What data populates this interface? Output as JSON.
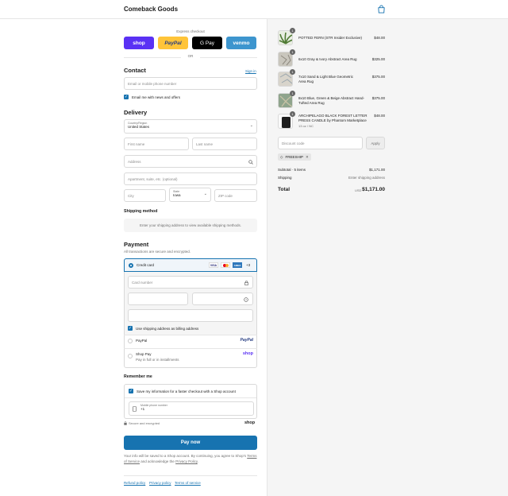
{
  "header": {
    "store_name": "Comeback Goods",
    "bag_icon": "shopping-bag-icon"
  },
  "express": {
    "label": "Express checkout",
    "buttons": [
      {
        "label": "shop",
        "color": "#5a31f4"
      },
      {
        "label": "PayPal",
        "color": "#ffc439"
      },
      {
        "label": "G Pay",
        "color": "#000000"
      },
      {
        "label": "venmo",
        "color": "#3d95ce"
      }
    ],
    "or_label": "OR"
  },
  "contact": {
    "title": "Contact",
    "sign_in": "Sign in",
    "email_placeholder": "Email or mobile phone number",
    "news_label": "Email me with news and offers"
  },
  "delivery": {
    "title": "Delivery",
    "country_label": "Country/Region",
    "country_value": "United States",
    "first_name": "First name",
    "last_name": "Last name",
    "address": "Address",
    "apartment": "Apartment, suite, etc. (optional)",
    "city": "City",
    "state_label": "State",
    "state_value": "Iowa",
    "zip": "ZIP code"
  },
  "shipping_method": {
    "title": "Shipping method",
    "message": "Enter your shipping address to view available shipping methods."
  },
  "payment": {
    "title": "Payment",
    "subtitle": "All transactions are secure and encrypted.",
    "credit_card": "Credit card",
    "card_brands": [
      "VISA",
      "MC",
      "AMEX"
    ],
    "more_brands": "+3",
    "card_number": "Card number",
    "billing_label": "Use shipping address as billing address",
    "paypal": "PayPal",
    "paypal_logo": "PayPal",
    "shop_pay": "Shop Pay",
    "shop_pay_sub": "Pay in full or in installments",
    "shop_logo": "shop"
  },
  "remember": {
    "title": "Remember me",
    "save_label": "Save my information for a faster checkout with a Shop account",
    "phone_label": "Mobile phone number",
    "phone_value": "+1",
    "secure_label": "Secure and encrypted",
    "shop_logo": "shop"
  },
  "pay_now": "Pay now",
  "legal": {
    "text1": "Your info will be saved to a Shop account. By continuing, you agree to Shop's",
    "terms": "Terms of Service",
    "text2": "and acknowledge the",
    "privacy": "Privacy Policy",
    "text3": "."
  },
  "footer_links": [
    "Refund policy",
    "Privacy policy",
    "Terms of service"
  ],
  "cart": {
    "items": [
      {
        "name": "POTTED FERN (STR Insider Exclusive)",
        "sub": "",
        "price": "$48.00",
        "qty": "1",
        "thumb": "#6b8a4a"
      },
      {
        "name": "6x10 Gray & Ivory Abstract Area Rug",
        "sub": "",
        "price": "$325.00",
        "qty": "1",
        "thumb": "#c9c6bd"
      },
      {
        "name": "7x10 Sand & Light Blue Geometric Area Rug",
        "sub": "",
        "price": "$375.00",
        "qty": "1",
        "thumb": "#cfcbc2"
      },
      {
        "name": "8x10 Blue, Green & Beige Abstract Hand-Tufted Area Rug",
        "sub": "",
        "price": "$375.00",
        "qty": "1",
        "thumb": "#8fa48c"
      },
      {
        "name": "ARCHIPELAGO BLACK FOREST LETTER PRESS CANDLE by Phantom Marketplace",
        "sub": "13 oz / NC",
        "price": "$48.00",
        "qty": "1",
        "thumb": "#1e1e1e"
      }
    ],
    "discount_placeholder": "Discount code",
    "apply": "Apply",
    "code": "FREESHIP",
    "subtotal_label": "Subtotal · 5 items",
    "subtotal_value": "$1,171.00",
    "shipping_label": "Shipping",
    "shipping_value": "Enter shipping address",
    "total_label": "Total",
    "currency": "USD",
    "total_value": "$1,171.00"
  }
}
